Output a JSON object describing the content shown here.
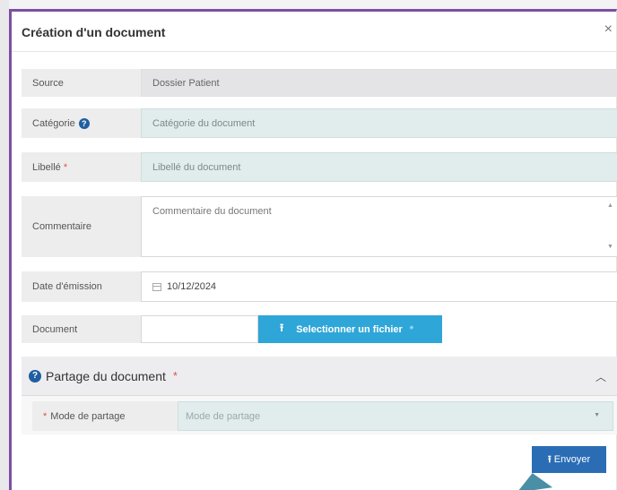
{
  "dialog": {
    "title": "Création d'un document",
    "close_symbol": "×"
  },
  "form": {
    "source": {
      "label": "Source",
      "value": "Dossier Patient"
    },
    "categorie": {
      "label": "Catégorie",
      "help": "?",
      "placeholder": "Catégorie du document"
    },
    "libelle": {
      "label": "Libellé",
      "required_mark": "*",
      "placeholder": "Libellé du document"
    },
    "commentaire": {
      "label": "Commentaire",
      "placeholder": "Commentaire du document"
    },
    "date_emission": {
      "label": "Date d'émission",
      "value": "10/12/2024"
    },
    "document": {
      "label": "Document",
      "button_label": "Selectionner un fichier",
      "required_mark": "*"
    }
  },
  "partage": {
    "title": "Partage du document",
    "help": "?",
    "required_mark": "*",
    "mode": {
      "label": "Mode de partage",
      "required_mark": "*",
      "placeholder": "Mode de partage"
    }
  },
  "actions": {
    "send_label": "Envoyer"
  },
  "colors": {
    "modal_border": "#7b4fa3",
    "upload_button": "#2fa6d8",
    "send_button": "#2a6db5",
    "required": "#d9534f",
    "help_icon": "#1f5fa0"
  }
}
